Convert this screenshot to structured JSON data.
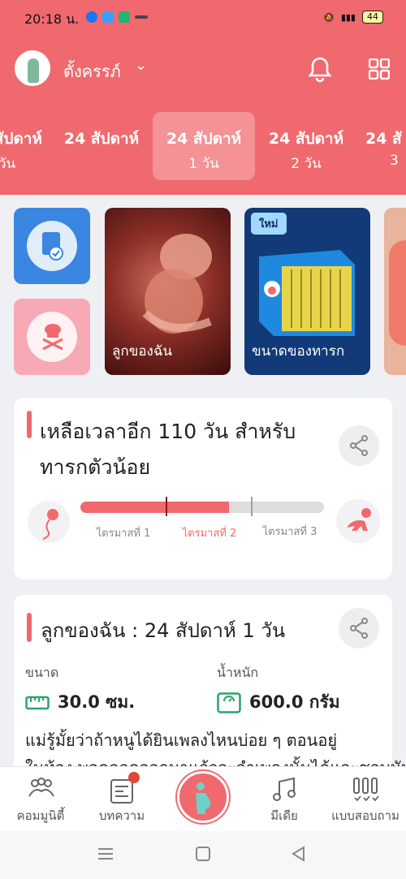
{
  "status": {
    "time": "20:18 น.",
    "battery": "44"
  },
  "header": {
    "profile_name": "ตั้งครรภ์"
  },
  "weeks": [
    {
      "title": "สัปดาห์",
      "sub": "วัน"
    },
    {
      "title": "24 สัปดาห์",
      "sub": ""
    },
    {
      "title": "24 สัปดาห์",
      "sub": "1 วัน"
    },
    {
      "title": "24 สัปดาห์",
      "sub": "2 วัน"
    },
    {
      "title": "24 สั",
      "sub": "3"
    }
  ],
  "cards": {
    "my_baby": "ลูกของฉัน",
    "baby_size": "ขนาดของทารก",
    "new_badge": "ใหม่"
  },
  "countdown": {
    "title": "เหลือเวลาอีก 110 วัน สำหรับทารกตัวน้อย",
    "progress_fraction": 0.61,
    "trimester1": "ไตรมาสที่ 1",
    "trimester2": "ไตรมาสที่ 2",
    "trimester3": "ไตรมาสที่ 3"
  },
  "baby": {
    "title": "ลูกของฉัน : 24 สัปดาห์ 1  วัน",
    "size_label": "ขนาด",
    "size_value": "30.0 ซม.",
    "weight_label": "น้ำหนัก",
    "weight_value": "600.0 กรัม",
    "desc_line1": "แม่รู้มั้ยว่าถ้าหนูได้ยินเพลงไหนบ่อย ๆ ตอนอยู่",
    "desc_line2": "ในท้อง พอคลอดออกมาแล้วจะจำเพลงนั้นได้และชอบมัน"
  },
  "tabs": [
    "คอมมูนิตี้",
    "บทความ",
    "",
    "มีเดีย",
    "แบบสอบถาม"
  ],
  "colors": {
    "brand": "#f0696e",
    "accent_blue": "#3a86e0",
    "accent_green": "#2aa36a"
  }
}
